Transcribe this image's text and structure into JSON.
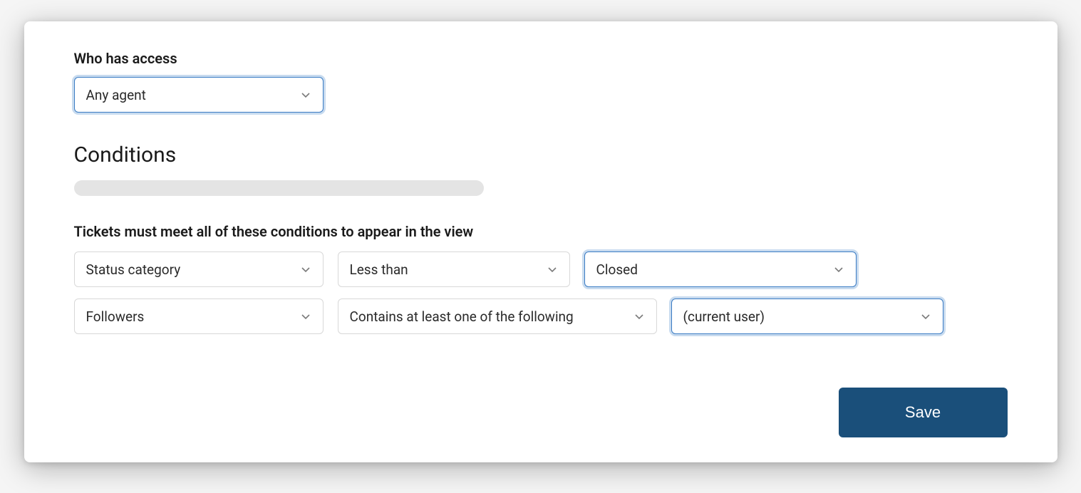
{
  "access": {
    "label": "Who has access",
    "value": "Any agent"
  },
  "conditions": {
    "title": "Conditions",
    "description": "Tickets must meet all of these conditions to appear in the view",
    "rows": [
      {
        "field": "Status category",
        "operator": "Less than",
        "value": "Closed"
      },
      {
        "field": "Followers",
        "operator": "Contains at least one of the following",
        "value": "(current user)"
      }
    ]
  },
  "actions": {
    "save": "Save"
  }
}
